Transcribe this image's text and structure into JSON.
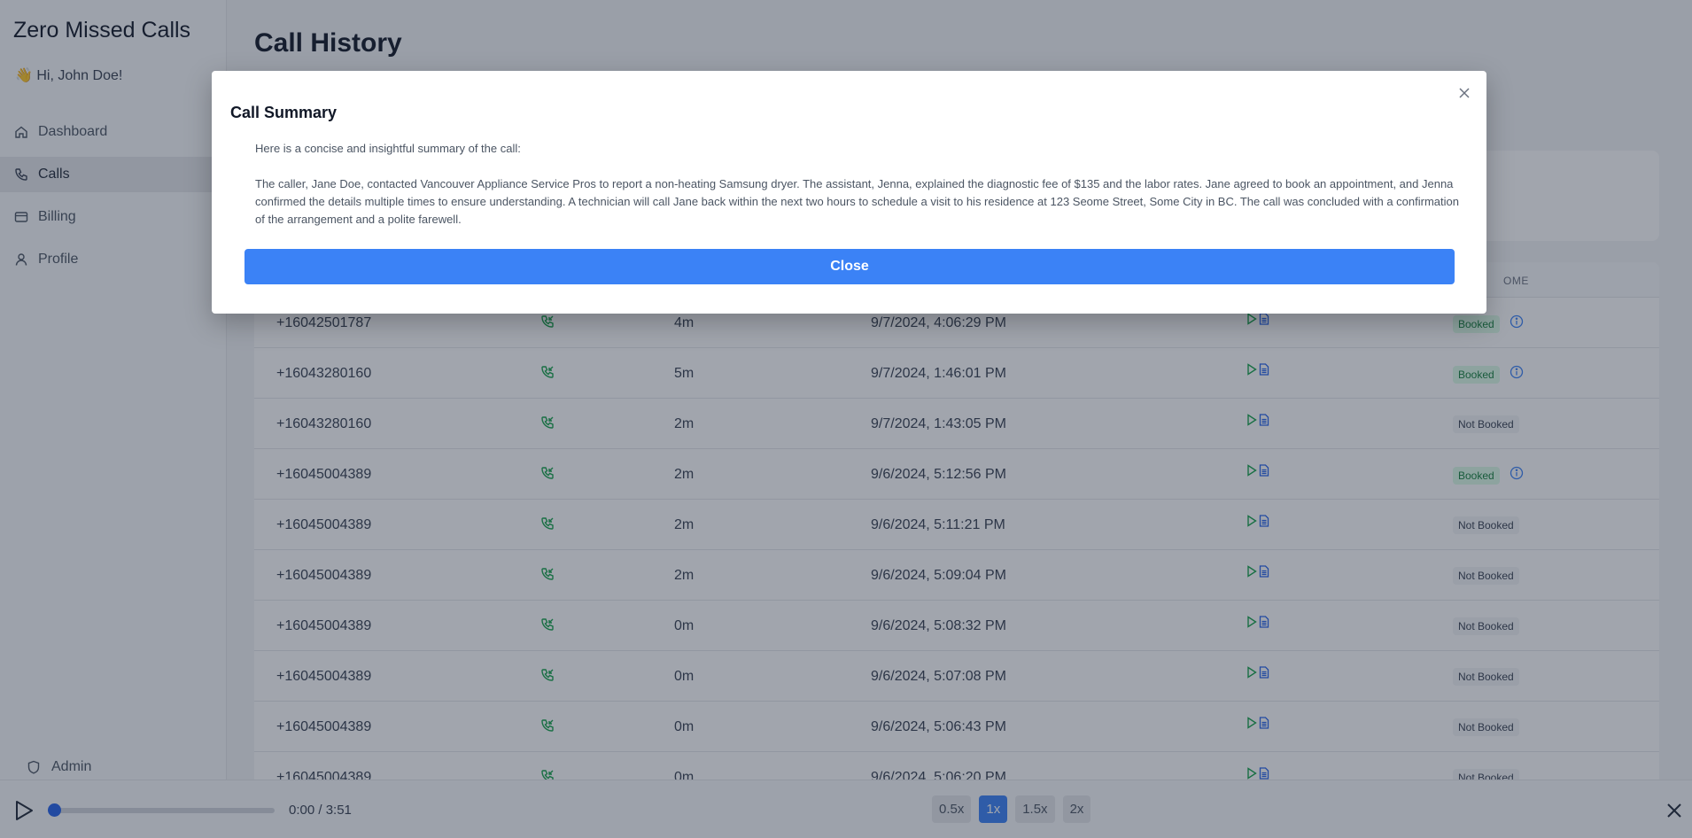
{
  "app": {
    "brand": "Zero Missed Calls",
    "greeting": "👋 Hi, John Doe!"
  },
  "sidebar": {
    "items": [
      {
        "label": "Dashboard",
        "icon": "home-icon"
      },
      {
        "label": "Calls",
        "icon": "phone-icon",
        "active": true
      },
      {
        "label": "Billing",
        "icon": "credit-card-icon"
      },
      {
        "label": "Profile",
        "icon": "user-icon"
      }
    ],
    "admin_label": "Admin"
  },
  "page": {
    "title": "Call History"
  },
  "table": {
    "visible_header": "OME",
    "rows": [
      {
        "phone": "+16042501787",
        "duration": "4m",
        "date": "9/7/2024, 4:06:29 PM",
        "outcome": "Booked",
        "info": true
      },
      {
        "phone": "+16043280160",
        "duration": "5m",
        "date": "9/7/2024, 1:46:01 PM",
        "outcome": "Booked",
        "info": true
      },
      {
        "phone": "+16043280160",
        "duration": "2m",
        "date": "9/7/2024, 1:43:05 PM",
        "outcome": "Not Booked",
        "info": false
      },
      {
        "phone": "+16045004389",
        "duration": "2m",
        "date": "9/6/2024, 5:12:56 PM",
        "outcome": "Booked",
        "info": true
      },
      {
        "phone": "+16045004389",
        "duration": "2m",
        "date": "9/6/2024, 5:11:21 PM",
        "outcome": "Not Booked",
        "info": false
      },
      {
        "phone": "+16045004389",
        "duration": "2m",
        "date": "9/6/2024, 5:09:04 PM",
        "outcome": "Not Booked",
        "info": false
      },
      {
        "phone": "+16045004389",
        "duration": "0m",
        "date": "9/6/2024, 5:08:32 PM",
        "outcome": "Not Booked",
        "info": false
      },
      {
        "phone": "+16045004389",
        "duration": "0m",
        "date": "9/6/2024, 5:07:08 PM",
        "outcome": "Not Booked",
        "info": false
      },
      {
        "phone": "+16045004389",
        "duration": "0m",
        "date": "9/6/2024, 5:06:43 PM",
        "outcome": "Not Booked",
        "info": false
      },
      {
        "phone": "+16045004389",
        "duration": "0m",
        "date": "9/6/2024, 5:06:20 PM",
        "outcome": "Not Booked",
        "info": false
      }
    ]
  },
  "player": {
    "time": "0:00 / 3:51",
    "progress": 0,
    "speeds": [
      "0.5x",
      "1x",
      "1.5x",
      "2x"
    ],
    "active_speed": "1x"
  },
  "modal": {
    "title": "Call Summary",
    "intro": "Here is a concise and insightful summary of the call:",
    "summary": "The caller, Jane Doe, contacted Vancouver Appliance Service Pros to report a non-heating Samsung dryer. The assistant, Jenna, explained the diagnostic fee of $135 and the labor rates. Jane agreed to book an appointment, and Jenna confirmed the details multiple times to ensure understanding. A technician will call Jane back within the next two hours to schedule a visit to his residence at 123 Seome Street, Some City in BC. The call was concluded with a confirmation of the arrangement and a polite farewell.",
    "close_label": "Close"
  },
  "colors": {
    "accent": "#3b82f6",
    "booked_bg": "#dcfce7",
    "booked_text": "#15803d",
    "call_icon": "#16a34a",
    "doc_icon": "#2563eb"
  }
}
